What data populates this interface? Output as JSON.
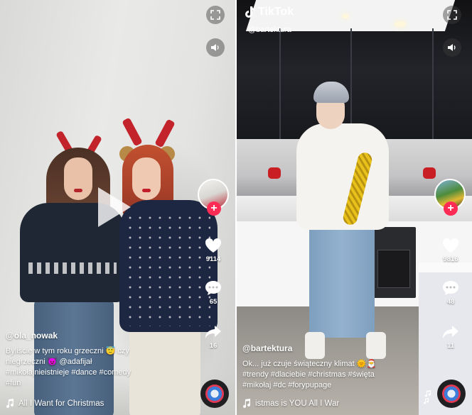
{
  "left_video": {
    "username": "@ola_nowak",
    "description_line1": "Byliście w tym roku grzeczni 😇 czy",
    "description_line2": "niegrzeczni 😈 @adafijał",
    "hashtags_line1": "#mikołajnieistnieje #dance #comedy",
    "hashtags_line2": "#fun",
    "music": "All I Want for Christmas",
    "likes": "9114",
    "comments": "65",
    "shares": "16",
    "icons": {
      "fullscreen": "fullscreen-icon",
      "volume": "volume-icon",
      "play": "play-icon",
      "like": "heart-icon",
      "comment": "comment-icon",
      "share": "share-icon",
      "music": "music-note-icon"
    }
  },
  "right_video": {
    "brand": "TikTok",
    "watermark_handle": "@bartektura",
    "username": "@bartektura",
    "description_line1": "Ok... już czuje świąteczny klimat 🌞🎅",
    "hashtags_line1": "#trendy #dlaciebie #christmas #święta",
    "hashtags_line2": "#mikołaj #dc #forypupage",
    "music": "istmas is YOU   All I War",
    "likes": "9816",
    "comments": "48",
    "shares": "11"
  },
  "colors": {
    "accent_plus": "#fe2c55",
    "overlay_text": "#ffffff"
  }
}
